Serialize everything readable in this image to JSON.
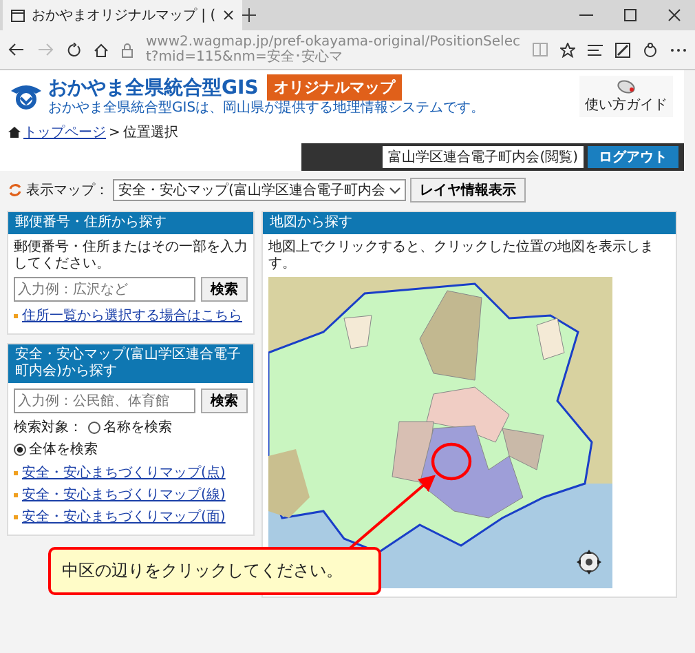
{
  "browser": {
    "tab_title": "おかやまオリジナルマップ | (",
    "url": "www2.wagmap.jp/pref-okayama-original/PositionSelect?mid=115&nm=安全･安心マ"
  },
  "header": {
    "logo_title": "おかやま全県統合型GIS",
    "logo_subtitle": "おかやま全県統合型GISは、岡山県が提供する地理情報システムです。",
    "badge": "オリジナルマップ",
    "guide_label": "使い方ガイド"
  },
  "breadcrumb": {
    "separator": ">",
    "items": [
      {
        "label": "トップページ",
        "kind": "link"
      },
      {
        "label": "位置選択",
        "kind": "current"
      }
    ]
  },
  "user_bar": {
    "user": "富山学区連合電子町内会(閲覧)",
    "logout": "ログアウト"
  },
  "map_select": {
    "label": "表示マップ：",
    "value": "安全・安心マップ(富山学区連合電子町内会",
    "layer_button": "レイヤ情報表示"
  },
  "panels": [
    {
      "title": "郵便番号・住所から探す",
      "instruction": "郵便番号・住所またはその一部を入力してください。",
      "placeholder": "入力例：広沢など",
      "button": "検索",
      "links": [
        "住所一覧から選択する場合はこちら"
      ]
    },
    {
      "title": "安全・安心マップ(富山学区連合電子町内会)から探す",
      "placeholder": "入力例：公民館、体育館",
      "button": "検索",
      "search_target": {
        "label": "検索対象：",
        "options": [
          {
            "label": "名称を検索",
            "selected": false
          },
          {
            "label": "全体を検索",
            "selected": true
          }
        ]
      },
      "links": [
        "安全・安心まちづくりマップ(点)",
        "安全・安心まちづくりマップ(線)",
        "安全・安心まちづくりマップ(面)"
      ]
    }
  ],
  "map_panel": {
    "title": "地図から探す",
    "instruction": "地図上でクリックすると、クリックした位置の地図を表示します。"
  },
  "callout": {
    "text": "中区の辺りをクリックしてください。"
  }
}
